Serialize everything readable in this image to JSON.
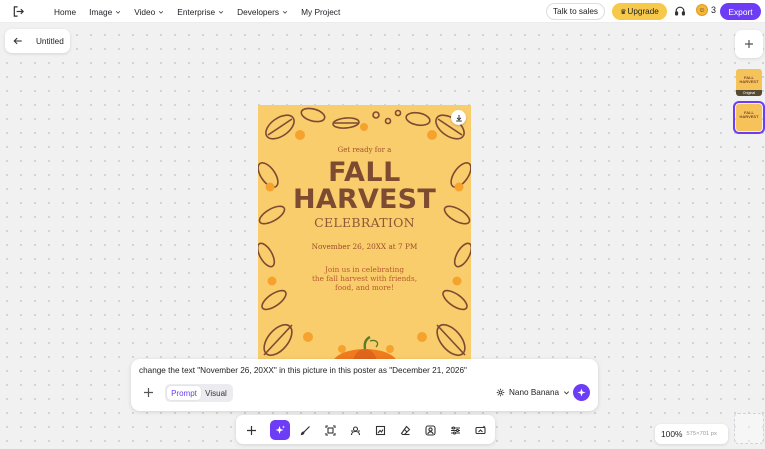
{
  "nav": {
    "items": [
      {
        "label": "Home",
        "dropdown": false
      },
      {
        "label": "Image",
        "dropdown": true
      },
      {
        "label": "Video",
        "dropdown": true
      },
      {
        "label": "Enterprise",
        "dropdown": true
      },
      {
        "label": "Developers",
        "dropdown": true
      },
      {
        "label": "My Project",
        "dropdown": false
      }
    ],
    "talk_label": "Talk to sales",
    "upgrade_label": "Upgrade",
    "credits": "3",
    "export_label": "Export"
  },
  "project": {
    "title": "Untitled"
  },
  "thumbnails": {
    "original_label": "Original",
    "thumb_text": "FALL HARVEST"
  },
  "poster": {
    "pre": "Get ready for a",
    "line1": "FALL",
    "line2": "HARVEST",
    "line3": "CELEBRATION",
    "date": "November 26, 20XX at 7 PM",
    "join1": "Join us in celebrating",
    "join2": "the fall harvest with friends,",
    "join3": "food, and more!"
  },
  "prompt": {
    "text": "change the text \"November 26, 20XX\" in this picture in this poster as \"December 21, 2026\"",
    "modes": [
      "Prompt",
      "Visual"
    ],
    "active_mode": "Prompt",
    "model": "Nano Banana"
  },
  "zoom": {
    "percent": "100%",
    "size": "575×701 px"
  },
  "colors": {
    "accent": "#6c3df5",
    "upgrade": "#f7c94b",
    "poster_bg": "#f9cd6c",
    "poster_text": "#7d4a32"
  },
  "icons": {
    "toolbar": [
      "plus-icon",
      "ai-sparkle-icon",
      "brush-icon",
      "expand-icon",
      "remove-bg-icon",
      "crop-icon",
      "eraser-icon",
      "portrait-icon",
      "adjust-icon",
      "upscale-icon"
    ]
  }
}
